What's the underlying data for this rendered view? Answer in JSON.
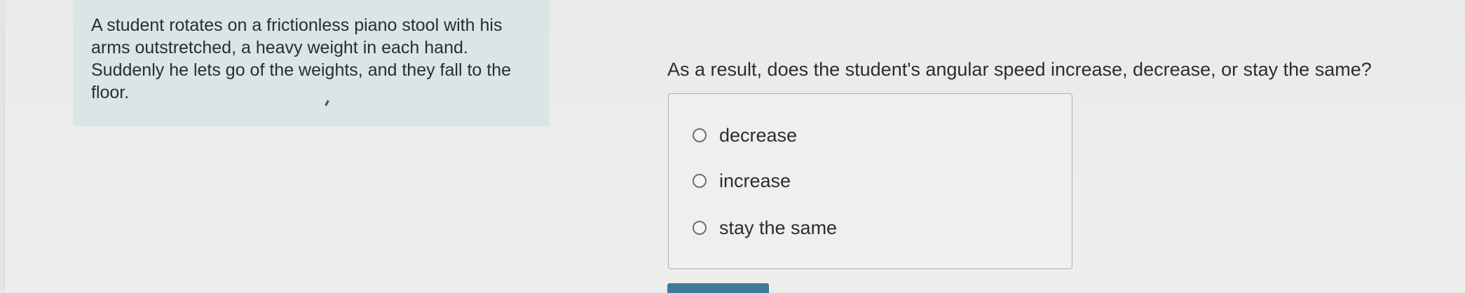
{
  "prompt": {
    "text": "A student rotates on a frictionless piano stool with his arms outstretched, a heavy weight in each hand. Suddenly he lets go of the weights, and they fall to the floor."
  },
  "question": {
    "text": "As a result, does the student's angular speed increase, decrease, or stay the same?"
  },
  "choices": [
    {
      "label": "decrease",
      "selected": false
    },
    {
      "label": "increase",
      "selected": false
    },
    {
      "label": "stay the same",
      "selected": false
    }
  ],
  "colors": {
    "prompt_panel_bg": "#d9e6e5",
    "page_bg": "#eceeec",
    "button_blue": "#3f7a9d",
    "choices_border": "#aeb1b3"
  }
}
